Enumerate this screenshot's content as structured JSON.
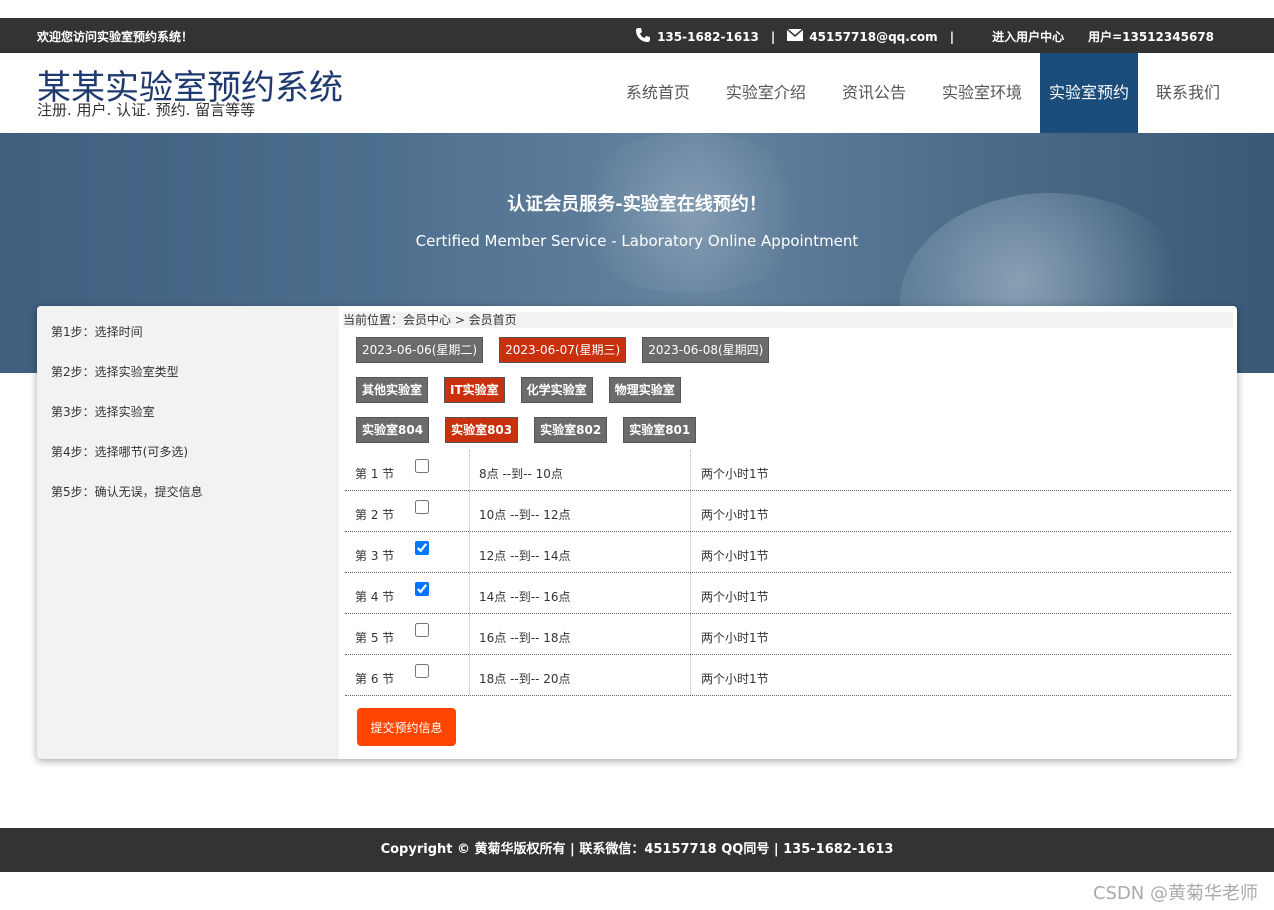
{
  "topbar": {
    "welcome": "欢迎您访问实验室预约系统！",
    "phone": "135-1682-1613",
    "separator": "|",
    "email": "45157718@qq.com",
    "user_center": "进入用户中心",
    "user": "用户=13512345678"
  },
  "header": {
    "title": "某某实验室预约系统",
    "subtitle": "注册. 用户. 认证. 预约. 留言等等"
  },
  "nav": [
    "系统首页",
    "实验室介绍",
    "资讯公告",
    "实验室环境",
    "实验室预约",
    "联系我们"
  ],
  "banner": {
    "title": "认证会员服务-实验室在线预约！",
    "subtitle": "Certified Member Service - Laboratory Online Appointment"
  },
  "steps": [
    "第1步：选择时间",
    "第2步：选择实验室类型",
    "第3步：选择实验室",
    "第4步：选择哪节(可多选)",
    "第5步：确认无误，提交信息"
  ],
  "breadcrumb": "当前位置：会员中心 > 会员首页",
  "dates": [
    {
      "label": "2023-06-06(星期二)",
      "selected": false
    },
    {
      "label": "2023-06-07(星期三)",
      "selected": true
    },
    {
      "label": "2023-06-08(星期四)",
      "selected": false
    }
  ],
  "lab_types": [
    {
      "label": "其他实验室",
      "selected": false
    },
    {
      "label": "IT实验室",
      "selected": true
    },
    {
      "label": "化学实验室",
      "selected": false
    },
    {
      "label": "物理实验室",
      "selected": false
    }
  ],
  "labs": [
    {
      "label": "实验室804",
      "selected": false
    },
    {
      "label": "实验室803",
      "selected": true
    },
    {
      "label": "实验室802",
      "selected": false
    },
    {
      "label": "实验室801",
      "selected": false
    }
  ],
  "sessions": [
    {
      "name": "第 1 节",
      "time": "8点 --到-- 10点",
      "duration": "两个小时1节",
      "checked": false
    },
    {
      "name": "第 2 节",
      "time": "10点 --到-- 12点",
      "duration": "两个小时1节",
      "checked": false
    },
    {
      "name": "第 3 节",
      "time": "12点 --到-- 14点",
      "duration": "两个小时1节",
      "checked": true
    },
    {
      "name": "第 4 节",
      "time": "14点 --到-- 16点",
      "duration": "两个小时1节",
      "checked": true
    },
    {
      "name": "第 5 节",
      "time": "16点 --到-- 18点",
      "duration": "两个小时1节",
      "checked": false
    },
    {
      "name": "第 6 节",
      "time": "18点 --到-- 20点",
      "duration": "两个小时1节",
      "checked": false
    }
  ],
  "submit_label": "提交预约信息",
  "footer": "Copyright © 黄菊华版权所有 | 联系微信：45157718 QQ同号 | 135-1682-1613",
  "watermark": "CSDN @黄菊华老师",
  "colors": {
    "nav_active": "#1a4d7a",
    "selected_tag": "#c9300e",
    "submit": "#ff4500",
    "topbar": "#333333"
  }
}
